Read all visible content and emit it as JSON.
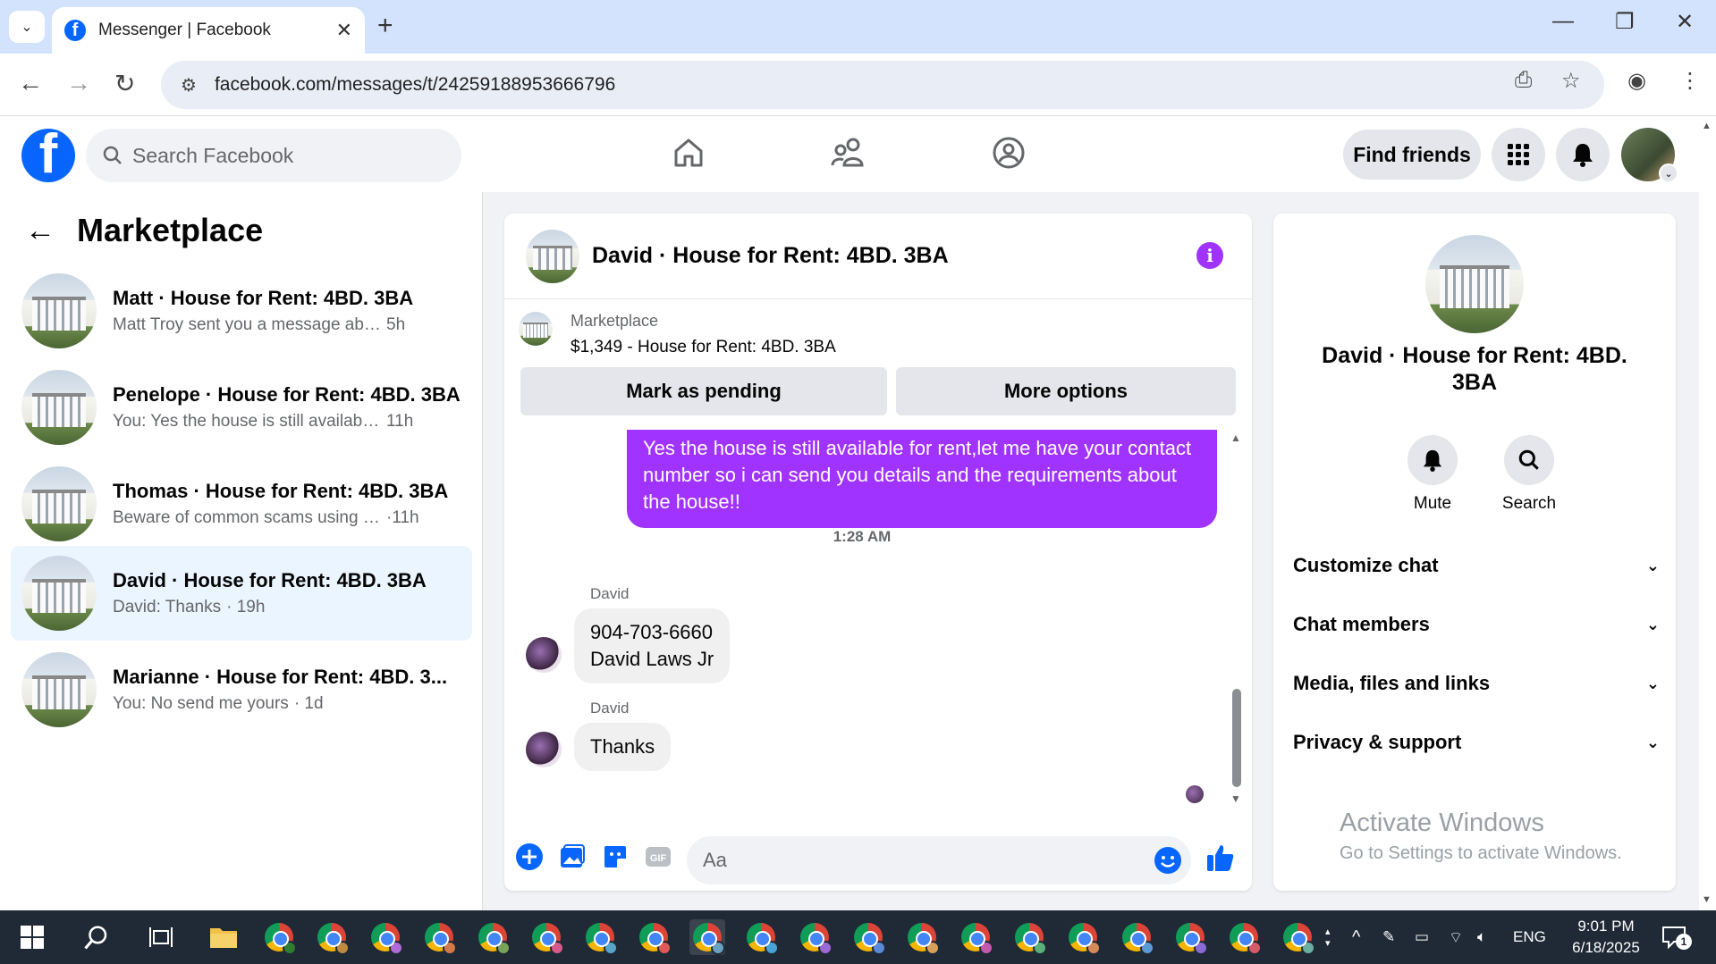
{
  "browser": {
    "tab_title": "Messenger | Facebook",
    "url": "facebook.com/messages/t/24259188953666796",
    "new_tab_label": "+"
  },
  "fb_header": {
    "search_placeholder": "Search Facebook",
    "find_friends_label": "Find friends",
    "brand_color": "#0866ff"
  },
  "left": {
    "title": "Marketplace",
    "conversations": [
      {
        "name": "Matt · House for Rent: 4BD. 3BA",
        "preview": "Matt Troy sent you a message about y...",
        "time": "5h",
        "active": false
      },
      {
        "name": "Penelope · House for Rent: 4BD. 3BA",
        "preview": "You: Yes the house is still available fo...",
        "time": "11h",
        "active": false
      },
      {
        "name": "Thomas · House for Rent: 4BD. 3BA",
        "preview": "Beware of common scams using pay...",
        "time": "·11h",
        "active": false
      },
      {
        "name": "David · House for Rent: 4BD. 3BA",
        "preview": "David: Thanks",
        "time": "· 19h",
        "active": true
      },
      {
        "name": "Marianne · House for Rent: 4BD. 3...",
        "preview": "You: No send me yours",
        "time": "· 1d",
        "active": false
      }
    ]
  },
  "chat": {
    "title": "David · House for Rent: 4BD. 3BA",
    "listing_label": "Marketplace",
    "listing_value": "$1,349 - House for Rent: 4BD. 3BA",
    "mark_pending_label": "Mark as pending",
    "more_options_label": "More options",
    "outgoing_message": "Yes the house is still available for rent,let me have your contact number so i can send you details and the requirements about the house!!",
    "timestamp": "1:28 AM",
    "messages": [
      {
        "sender": "David",
        "line1": "904-703-6660",
        "line2": "David Laws Jr"
      },
      {
        "sender": "David",
        "line1": "Thanks",
        "line2": ""
      }
    ],
    "composer_placeholder": "Aa",
    "accent_color": "#a033ff"
  },
  "right": {
    "name": "David · House for Rent: 4BD. 3BA",
    "mute_label": "Mute",
    "search_label": "Search",
    "sections": [
      "Customize chat",
      "Chat members",
      "Media, files and links",
      "Privacy & support"
    ],
    "activate_line1": "Activate Windows",
    "activate_line2": "Go to Settings to activate Windows."
  },
  "taskbar": {
    "lang": "ENG",
    "time": "9:01 PM",
    "date": "6/18/2025",
    "notification_count": "1"
  }
}
